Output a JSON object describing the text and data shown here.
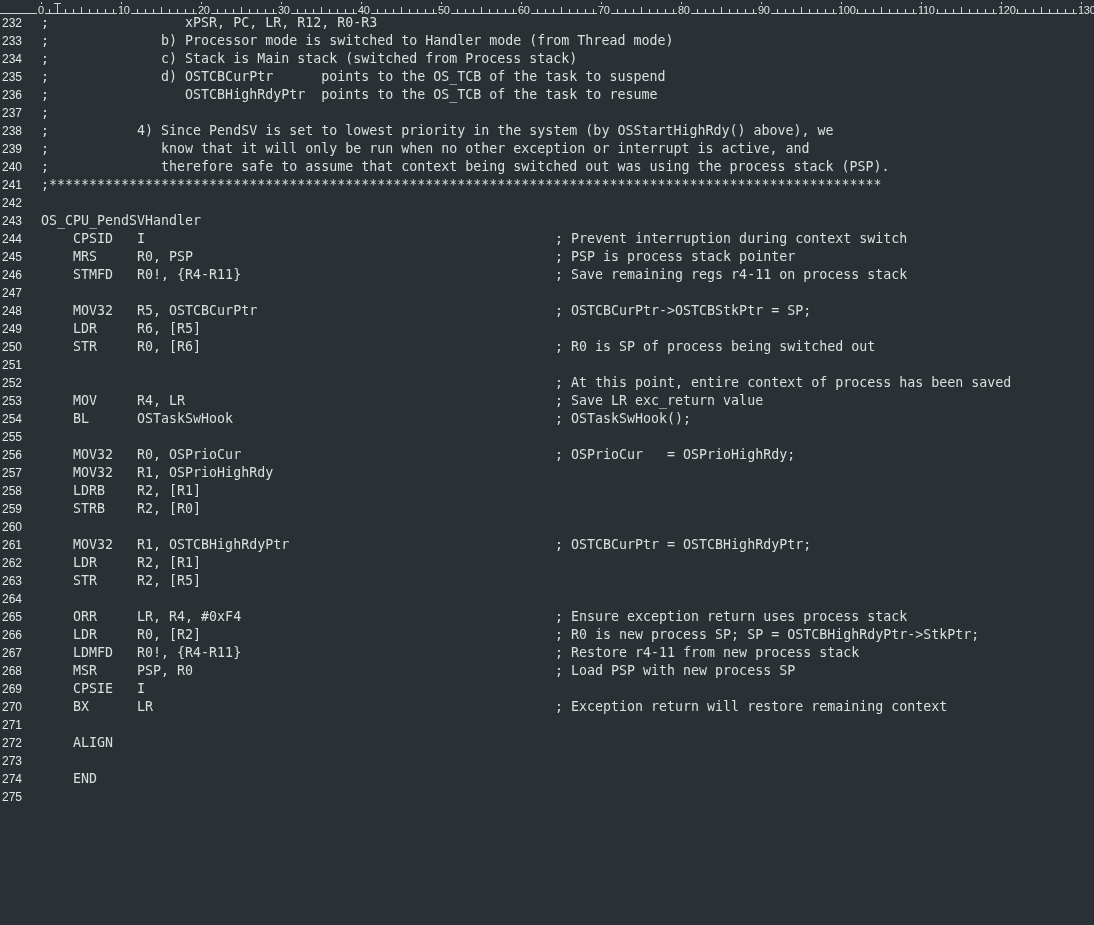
{
  "ruler": {
    "labels": [
      "0",
      "10",
      "20",
      "30",
      "40",
      "50",
      "60",
      "70",
      "80",
      "90",
      "100",
      "110",
      "120",
      "130"
    ]
  },
  "lines": [
    {
      "number": "232",
      "code": ";                 xPSR, PC, LR, R12, R0-R3"
    },
    {
      "number": "233",
      "code": ";              b) Processor mode is switched to Handler mode (from Thread mode)"
    },
    {
      "number": "234",
      "code": ";              c) Stack is Main stack (switched from Process stack)"
    },
    {
      "number": "235",
      "code": ";              d) OSTCBCurPtr      points to the OS_TCB of the task to suspend"
    },
    {
      "number": "236",
      "code": ";                 OSTCBHighRdyPtr  points to the OS_TCB of the task to resume"
    },
    {
      "number": "237",
      "code": ";"
    },
    {
      "number": "238",
      "code": ";           4) Since PendSV is set to lowest priority in the system (by OSStartHighRdy() above), we"
    },
    {
      "number": "239",
      "code": ";              know that it will only be run when no other exception or interrupt is active, and"
    },
    {
      "number": "240",
      "code": ";              therefore safe to assume that context being switched out was using the process stack (PSP)."
    },
    {
      "number": "241",
      "code": ";********************************************************************************************************"
    },
    {
      "number": "242"
    },
    {
      "number": "243",
      "code": "OS_CPU_PendSVHandler"
    },
    {
      "number": "244",
      "code": "    CPSID   I",
      "comment": "; Prevent interruption during context switch"
    },
    {
      "number": "245",
      "code": "    MRS     R0, PSP",
      "comment": "; PSP is process stack pointer"
    },
    {
      "number": "246",
      "code": "    STMFD   R0!, {R4-R11}",
      "comment": "; Save remaining regs r4-11 on process stack"
    },
    {
      "number": "247"
    },
    {
      "number": "248",
      "code": "    MOV32   R5, OSTCBCurPtr",
      "comment": "; OSTCBCurPtr->OSTCBStkPtr = SP;"
    },
    {
      "number": "249",
      "code": "    LDR     R6, [R5]"
    },
    {
      "number": "250",
      "code": "    STR     R0, [R6]",
      "comment": "; R0 is SP of process being switched out"
    },
    {
      "number": "251"
    },
    {
      "number": "252",
      "comment": "; At this point, entire context of process has been saved"
    },
    {
      "number": "253",
      "code": "    MOV     R4, LR",
      "comment": "; Save LR exc_return value"
    },
    {
      "number": "254",
      "code": "    BL      OSTaskSwHook",
      "comment": "; OSTaskSwHook();"
    },
    {
      "number": "255"
    },
    {
      "number": "256",
      "code": "    MOV32   R0, OSPrioCur",
      "comment": "; OSPrioCur   = OSPrioHighRdy;"
    },
    {
      "number": "257",
      "code": "    MOV32   R1, OSPrioHighRdy"
    },
    {
      "number": "258",
      "code": "    LDRB    R2, [R1]"
    },
    {
      "number": "259",
      "code": "    STRB    R2, [R0]"
    },
    {
      "number": "260"
    },
    {
      "number": "261",
      "code": "    MOV32   R1, OSTCBHighRdyPtr",
      "comment": "; OSTCBCurPtr = OSTCBHighRdyPtr;"
    },
    {
      "number": "262",
      "code": "    LDR     R2, [R1]"
    },
    {
      "number": "263",
      "code": "    STR     R2, [R5]"
    },
    {
      "number": "264"
    },
    {
      "number": "265",
      "code": "    ORR     LR, R4, #0xF4",
      "comment": "; Ensure exception return uses process stack"
    },
    {
      "number": "266",
      "code": "    LDR     R0, [R2]",
      "comment": "; R0 is new process SP; SP = OSTCBHighRdyPtr->StkPtr;"
    },
    {
      "number": "267",
      "code": "    LDMFD   R0!, {R4-R11}",
      "comment": "; Restore r4-11 from new process stack"
    },
    {
      "number": "268",
      "code": "    MSR     PSP, R0",
      "comment": "; Load PSP with new process SP"
    },
    {
      "number": "269",
      "code": "    CPSIE   I"
    },
    {
      "number": "270",
      "code": "    BX      LR",
      "comment": "; Exception return will restore remaining context"
    },
    {
      "number": "271"
    },
    {
      "number": "272",
      "code": "    ALIGN"
    },
    {
      "number": "273"
    },
    {
      "number": "274",
      "code": "    END"
    },
    {
      "number": "275"
    }
  ]
}
